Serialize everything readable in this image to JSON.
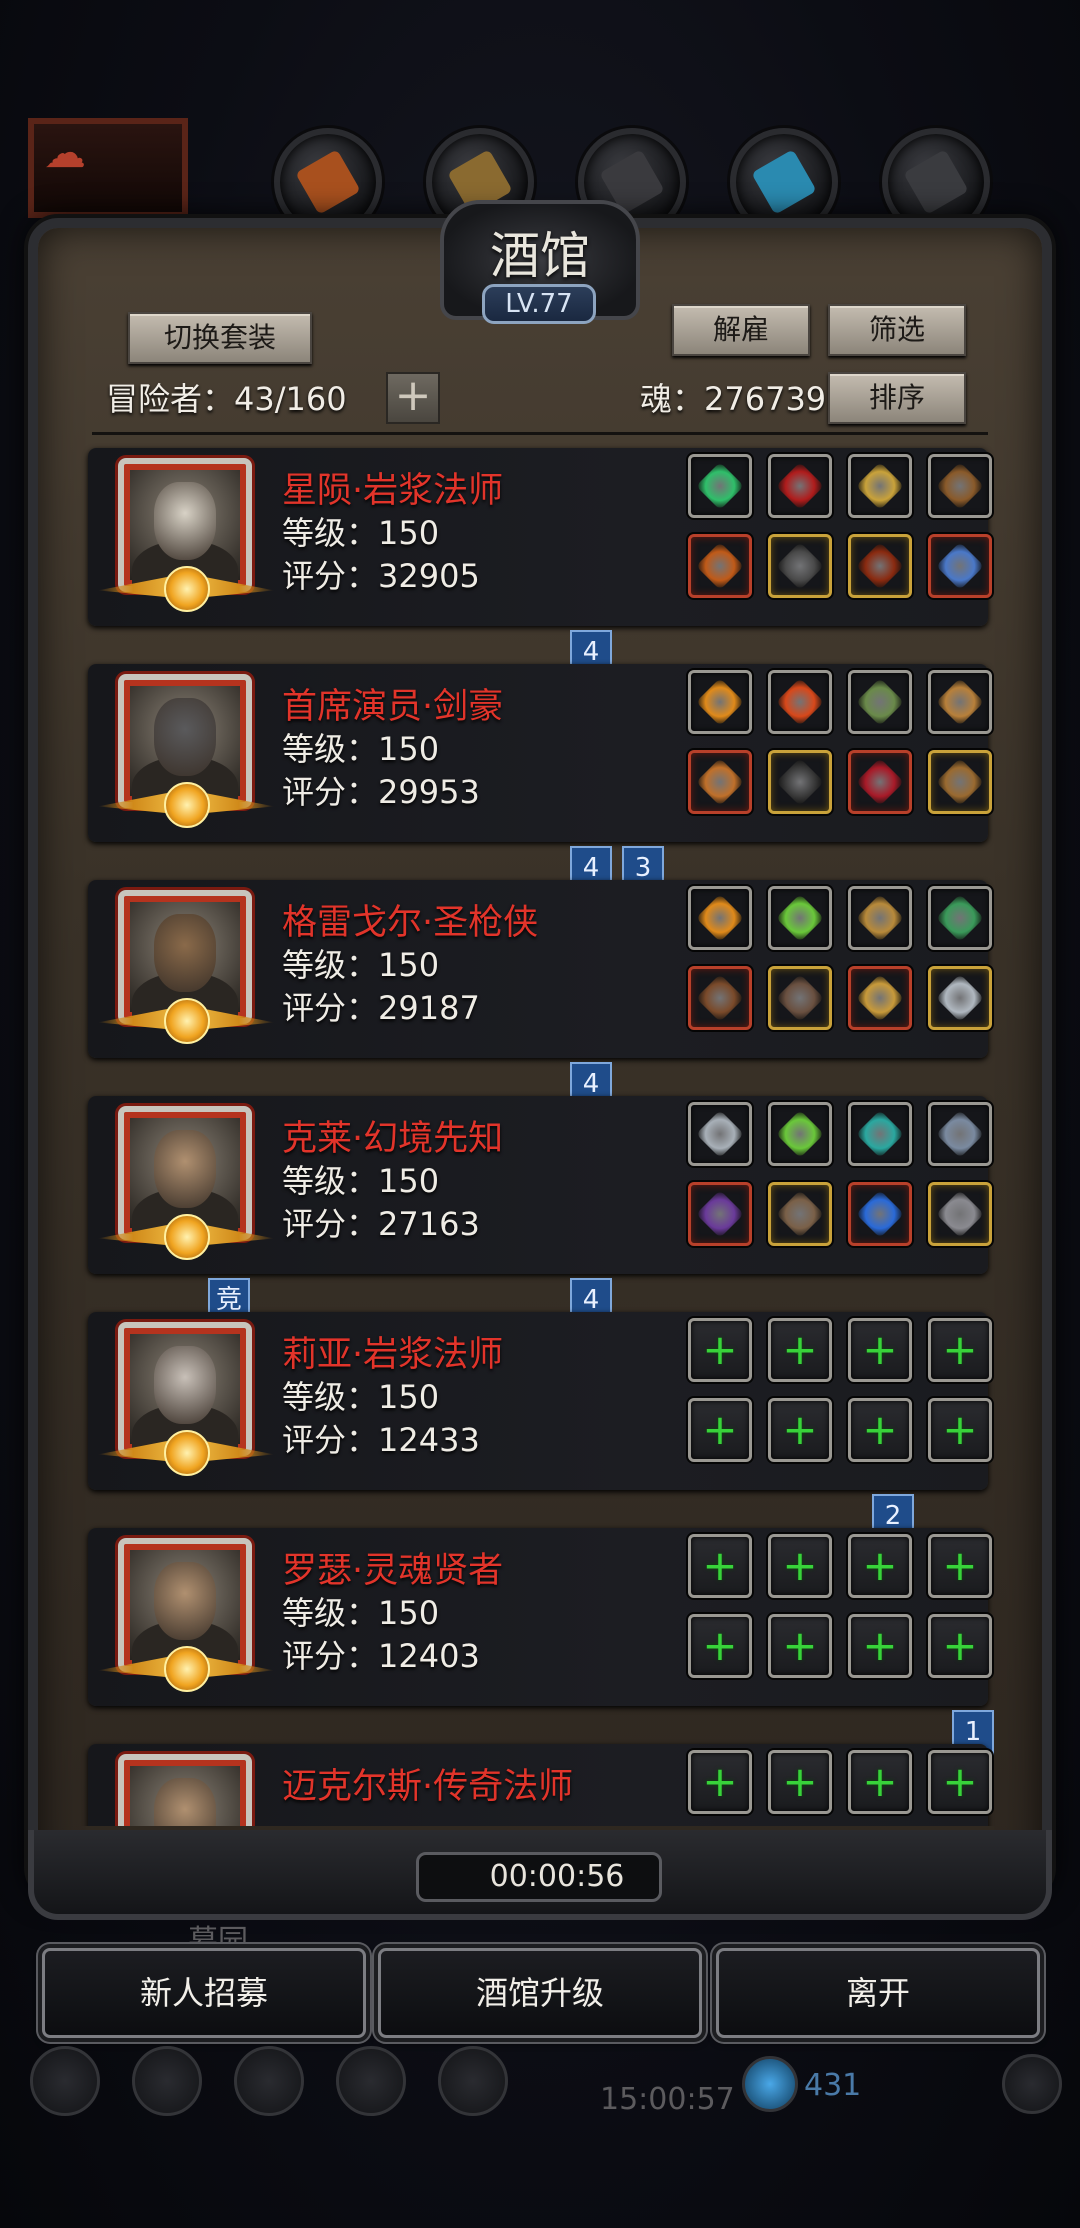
{
  "tavern": {
    "title": "酒馆",
    "level": "LV.77",
    "switch_set_label": "切换套装",
    "dismiss_label": "解雇",
    "filter_label": "筛选",
    "sort_label": "排序",
    "adventurers_label": "冒险者：43/160",
    "soul_label": "魂：276739",
    "add_icon": "plus-icon"
  },
  "heroes": [
    {
      "name": "星陨·岩浆法师",
      "level_label": "等级：150",
      "score_label": "评分：32905",
      "portrait": "white-haired-elf-mage",
      "skin": "#d8d2c6",
      "equip": [
        {
          "frame": "gray",
          "color": "#2fbf6a"
        },
        {
          "frame": "gray",
          "color": "#b01c1c"
        },
        {
          "frame": "gray",
          "color": "#c9a23a"
        },
        {
          "frame": "gray",
          "color": "#8a5a2a"
        },
        {
          "frame": "red",
          "color": "#c05a18"
        },
        {
          "frame": "gold",
          "color": "#4a4a4a"
        },
        {
          "frame": "gold",
          "color": "#8a2a10"
        },
        {
          "frame": "red",
          "color": "#4a78c8"
        }
      ],
      "ribbons": [
        {
          "text": "4"
        }
      ]
    },
    {
      "name": "首席演员·剑豪",
      "level_label": "等级：150",
      "score_label": "评分：29953",
      "portrait": "iron-helmet-warrior",
      "skin": "#5a5a5c",
      "equip": [
        {
          "frame": "gray",
          "color": "#e08a1a"
        },
        {
          "frame": "gray",
          "color": "#d8481a"
        },
        {
          "frame": "gray",
          "color": "#6a8a4a"
        },
        {
          "frame": "gray",
          "color": "#b8803a"
        },
        {
          "frame": "red",
          "color": "#c0702a"
        },
        {
          "frame": "gold",
          "color": "#3a3a3a"
        },
        {
          "frame": "red",
          "color": "#a81a28"
        },
        {
          "frame": "gold",
          "color": "#9a6a30"
        }
      ],
      "ribbons": [
        {
          "text": "4"
        },
        {
          "text": "3"
        }
      ]
    },
    {
      "name": "格雷戈尔·圣枪侠",
      "level_label": "等级：150",
      "score_label": "评分：29187",
      "portrait": "hat-gunslinger",
      "skin": "#8a6a4a",
      "equip": [
        {
          "frame": "gray",
          "color": "#e08a1a"
        },
        {
          "frame": "gray",
          "color": "#6ac83a"
        },
        {
          "frame": "gray",
          "color": "#b88a3a"
        },
        {
          "frame": "gray",
          "color": "#3a9a5a"
        },
        {
          "frame": "red",
          "color": "#7a4a2a"
        },
        {
          "frame": "gold",
          "color": "#6a5040"
        },
        {
          "frame": "red",
          "color": "#c89a3a"
        },
        {
          "frame": "gold",
          "color": "#b0b8c0"
        }
      ],
      "ribbons": [
        {
          "text": "4"
        }
      ]
    },
    {
      "name": "克莱·幻境先知",
      "level_label": "等级：150",
      "score_label": "评分：27163",
      "portrait": "bearded-sage",
      "skin": "#b09070",
      "equip": [
        {
          "frame": "gray",
          "color": "#a8b0b8"
        },
        {
          "frame": "gray",
          "color": "#6ac83a"
        },
        {
          "frame": "gray",
          "color": "#2aa8a0"
        },
        {
          "frame": "gray",
          "color": "#7a8aa0"
        },
        {
          "frame": "red",
          "color": "#6a3a9a"
        },
        {
          "frame": "gold",
          "color": "#7a6048"
        },
        {
          "frame": "red",
          "color": "#2a6ad8"
        },
        {
          "frame": "gold",
          "color": "#8a8a90"
        }
      ],
      "ribbons": [
        {
          "text": "竞"
        },
        {
          "text": "4"
        }
      ]
    },
    {
      "name": "莉亚·岩浆法师",
      "level_label": "等级：150",
      "score_label": "评分：12433",
      "portrait": "hooded-sorceress",
      "skin": "#c8c0b8",
      "equip": [
        {
          "frame": "gray",
          "plus": "+"
        },
        {
          "frame": "gray",
          "plus": "+"
        },
        {
          "frame": "gray",
          "plus": "+"
        },
        {
          "frame": "gray",
          "plus": "+"
        },
        {
          "frame": "gray",
          "plus": "+"
        },
        {
          "frame": "gray",
          "plus": "+"
        },
        {
          "frame": "gray",
          "plus": "+"
        },
        {
          "frame": "gray",
          "plus": "+"
        }
      ],
      "ribbons": [
        {
          "text": "2"
        }
      ]
    },
    {
      "name": "罗瑟·灵魂贤者",
      "level_label": "等级：150",
      "score_label": "评分：12403",
      "portrait": "bearded-sage",
      "skin": "#b09070",
      "equip": [
        {
          "frame": "gray",
          "plus": "+"
        },
        {
          "frame": "gray",
          "plus": "+"
        },
        {
          "frame": "gray",
          "plus": "+"
        },
        {
          "frame": "gray",
          "plus": "+"
        },
        {
          "frame": "gray",
          "plus": "+"
        },
        {
          "frame": "gray",
          "plus": "+"
        },
        {
          "frame": "gray",
          "plus": "+"
        },
        {
          "frame": "gray",
          "plus": "+"
        }
      ],
      "ribbons": [
        {
          "text": "1"
        }
      ]
    },
    {
      "name": "迈克尔斯·传奇法师",
      "level_label": "",
      "score_label": "",
      "portrait": "bearded-sage",
      "skin": "#b09070",
      "equip": [
        {
          "frame": "gray",
          "plus": "+"
        },
        {
          "frame": "gray",
          "plus": "+"
        },
        {
          "frame": "gray",
          "plus": "+"
        },
        {
          "frame": "gray",
          "plus": "+"
        }
      ],
      "ribbons": []
    }
  ],
  "footer": {
    "timer": "00:00:56",
    "recruit_label": "新人招募",
    "upgrade_label": "酒馆升级",
    "leave_label": "离开",
    "bg_place_label": "墓园",
    "bg_clock": "15:00:57",
    "bg_gems": "431"
  },
  "colors": {
    "hero_name": "#e2342a",
    "level_badge_border": "#8da4c0",
    "add_slot_green": "#38d33a",
    "ribbon_blue": "#1f4c8a"
  }
}
